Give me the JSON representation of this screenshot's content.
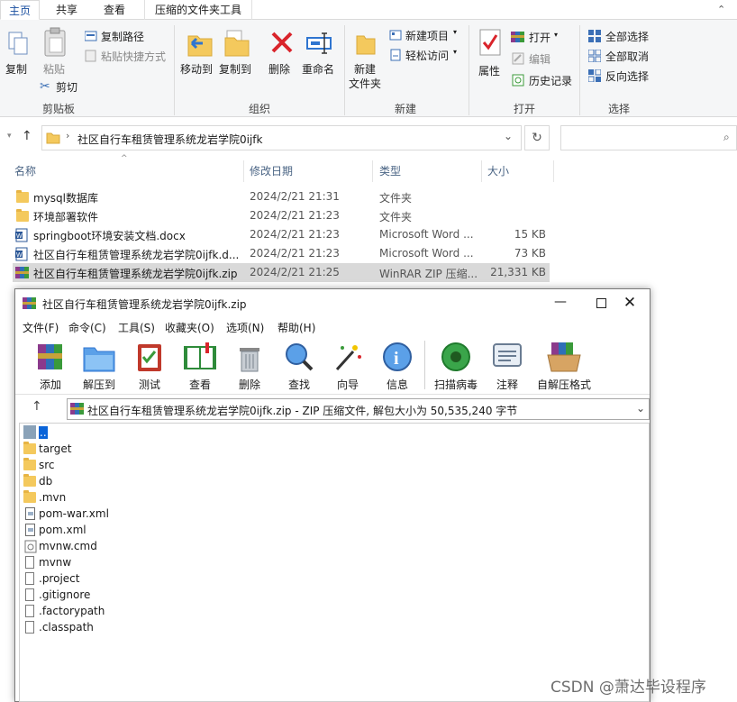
{
  "ribbon": {
    "tabs": [
      "主页",
      "共享",
      "查看",
      "压缩的文件夹工具"
    ],
    "clipboard": {
      "copy": "复制",
      "paste": "粘贴",
      "copy_path": "复制路径",
      "paste_shortcut": "粘贴快捷方式",
      "cut": "剪切",
      "label": "剪贴板"
    },
    "organize": {
      "move_to": "移动到",
      "copy_to": "复制到",
      "delete": "删除",
      "rename": "重命名",
      "label": "组织"
    },
    "new": {
      "new_folder": "新建\n文件夹",
      "new_folder_line1": "新建",
      "new_folder_line2": "文件夹",
      "new_item": "新建项目",
      "easy_access": "轻松访问",
      "label": "新建"
    },
    "open": {
      "properties": "属性",
      "open": "打开",
      "edit": "编辑",
      "history": "历史记录",
      "label": "打开"
    },
    "select": {
      "select_all": "全部选择",
      "select_none": "全部取消",
      "invert": "反向选择",
      "label": "选择"
    }
  },
  "address": {
    "path": "社区自行车租赁管理系统龙岩学院0ijfk"
  },
  "columns": {
    "name": "名称",
    "date": "修改日期",
    "type": "类型",
    "size": "大小"
  },
  "files": [
    {
      "name": "mysql数据库",
      "date": "2024/2/21 21:31",
      "type": "文件夹",
      "size": "",
      "icon": "folder"
    },
    {
      "name": "环境部署软件",
      "date": "2024/2/21 21:23",
      "type": "文件夹",
      "size": "",
      "icon": "folder"
    },
    {
      "name": "springboot环境安装文档.docx",
      "date": "2024/2/21 21:23",
      "type": "Microsoft Word ...",
      "size": "15 KB",
      "icon": "word"
    },
    {
      "name": "社区自行车租赁管理系统龙岩学院0ijfk.d...",
      "date": "2024/2/21 21:23",
      "type": "Microsoft Word ...",
      "size": "73 KB",
      "icon": "word"
    },
    {
      "name": "社区自行车租赁管理系统龙岩学院0ijfk.zip",
      "date": "2024/2/21 21:25",
      "type": "WinRAR ZIP 压缩...",
      "size": "21,331 KB",
      "icon": "winrar"
    }
  ],
  "winrar": {
    "title": "社区自行车租赁管理系统龙岩学院0ijfk.zip",
    "menus": [
      "文件(F)",
      "命令(C)",
      "工具(S)",
      "收藏夹(O)",
      "选项(N)",
      "帮助(H)"
    ],
    "toolbar": [
      "添加",
      "解压到",
      "测试",
      "查看",
      "删除",
      "查找",
      "向导",
      "信息",
      "扫描病毒",
      "注释",
      "自解压格式"
    ],
    "path": "社区自行车租赁管理系统龙岩学院0ijfk.zip - ZIP 压缩文件, 解包大小为 50,535,240 字节",
    "items": [
      {
        "name": "..",
        "icon": "up"
      },
      {
        "name": "target",
        "icon": "folder"
      },
      {
        "name": "src",
        "icon": "folder"
      },
      {
        "name": "db",
        "icon": "folder"
      },
      {
        "name": ".mvn",
        "icon": "folder"
      },
      {
        "name": "pom-war.xml",
        "icon": "xml"
      },
      {
        "name": "pom.xml",
        "icon": "xml"
      },
      {
        "name": "mvnw.cmd",
        "icon": "cmd"
      },
      {
        "name": "mvnw",
        "icon": "file"
      },
      {
        "name": ".project",
        "icon": "file"
      },
      {
        "name": ".gitignore",
        "icon": "file"
      },
      {
        "name": ".factorypath",
        "icon": "file"
      },
      {
        "name": ".classpath",
        "icon": "file"
      }
    ]
  },
  "watermark": "CSDN @萧达毕设程序",
  "colors": {
    "accent": "#1a4fa0",
    "selected_row": "#d9d9d9",
    "folder": "#f4c95d",
    "delete_red": "#d9242b"
  }
}
